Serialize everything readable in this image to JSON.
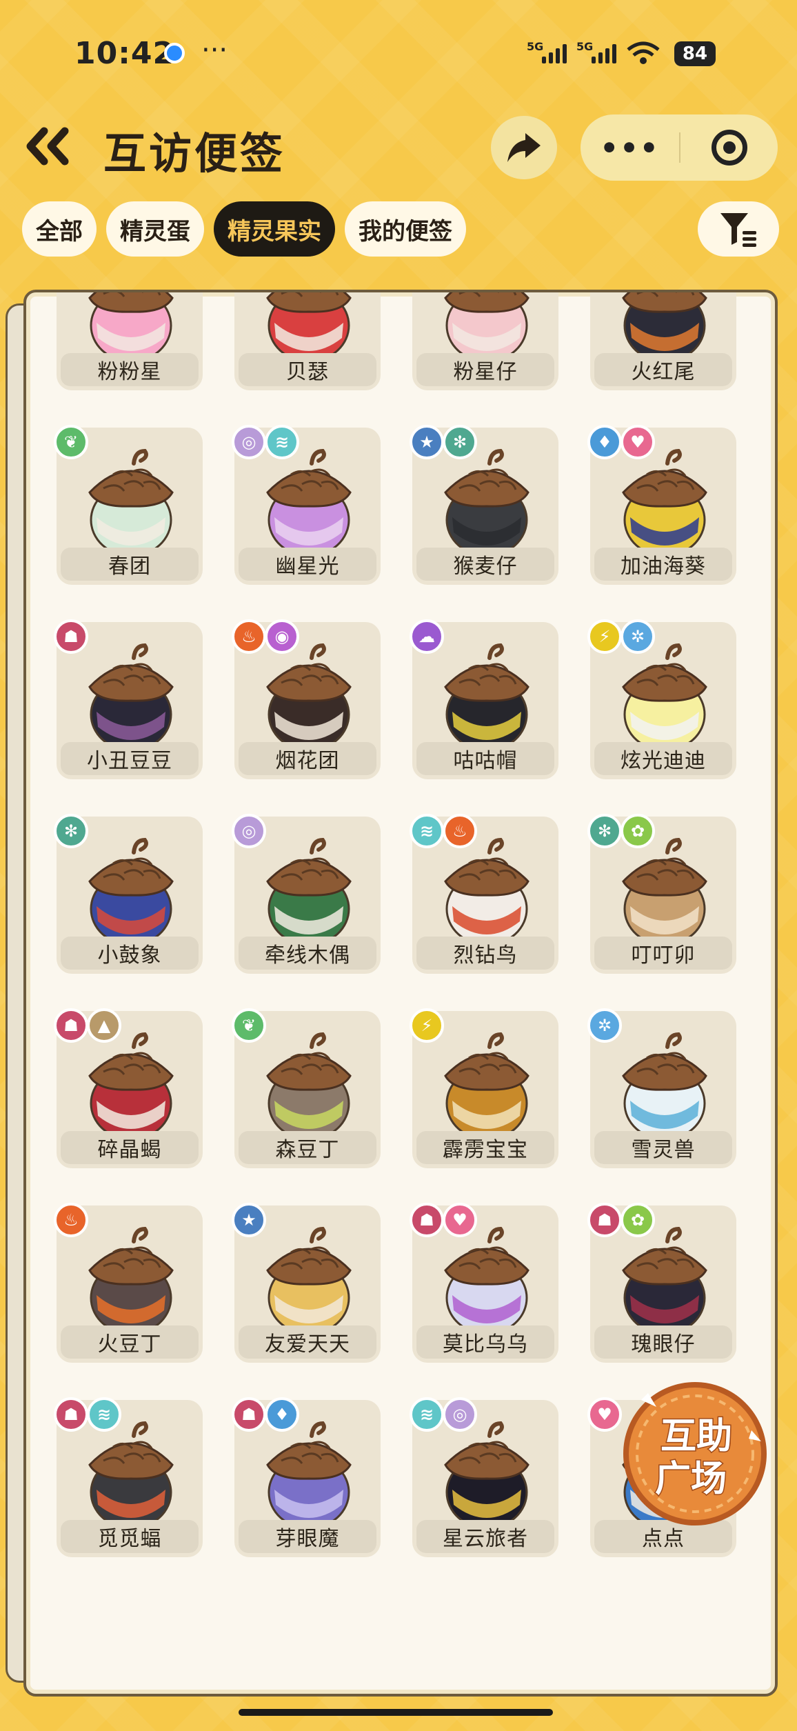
{
  "status_bar": {
    "time": "10:42",
    "more": "···",
    "sim1": "5G",
    "sim2": "5G",
    "battery": "84"
  },
  "header": {
    "title": "互访便签",
    "capsule_more": "•••"
  },
  "tabs": [
    {
      "label": "全部",
      "active": false
    },
    {
      "label": "精灵蛋",
      "active": false
    },
    {
      "label": "精灵果实",
      "active": true
    },
    {
      "label": "我的便签",
      "active": false
    }
  ],
  "colors": {
    "background": "#f7c94a",
    "panel": "#fbf7ee",
    "active_tab_bg": "#1e1a14",
    "active_tab_text": "#f6c65a"
  },
  "items": [
    {
      "name": "粉粉星",
      "badges": [],
      "colors": [
        "#f7a8c8",
        "#f2e8e0"
      ]
    },
    {
      "name": "贝瑟",
      "badges": [],
      "colors": [
        "#d94040",
        "#f2ece2"
      ]
    },
    {
      "name": "粉星仔",
      "badges": [],
      "colors": [
        "#f4c8cc",
        "#f2e8e0"
      ]
    },
    {
      "name": "火红尾",
      "badges": [],
      "colors": [
        "#2c2c38",
        "#e07a30"
      ]
    },
    {
      "name": "春团",
      "badges": [
        {
          "icon": "leaf-icon",
          "color": "#5dbb6a",
          "glyph": "❦"
        }
      ],
      "colors": [
        "#d6ead8",
        "#f2ece2"
      ]
    },
    {
      "name": "幽星光",
      "badges": [
        {
          "icon": "swirl-icon",
          "color": "#b89bd8",
          "glyph": "◎"
        },
        {
          "icon": "wing-icon",
          "color": "#5fc6c8",
          "glyph": "≋"
        }
      ],
      "colors": [
        "#c990e0",
        "#ead2f0"
      ]
    },
    {
      "name": "猴麦仔",
      "badges": [
        {
          "icon": "star-icon",
          "color": "#4a7fc0",
          "glyph": "★"
        },
        {
          "icon": "gear-icon",
          "color": "#4fa890",
          "glyph": "✻"
        }
      ],
      "colors": [
        "#3a3c40",
        "#2a2c30"
      ]
    },
    {
      "name": "加油海葵",
      "badges": [
        {
          "icon": "water-icon",
          "color": "#4a9ad8",
          "glyph": "♦"
        },
        {
          "icon": "heart-icon",
          "color": "#e86890",
          "glyph": "♥"
        }
      ],
      "colors": [
        "#e8c83a",
        "#2a3a90"
      ]
    },
    {
      "name": "小丑豆豆",
      "badges": [
        {
          "icon": "demon-icon",
          "color": "#c84a6a",
          "glyph": "☗"
        }
      ],
      "colors": [
        "#2a2838",
        "#8c5a9a"
      ]
    },
    {
      "name": "烟花团",
      "badges": [
        {
          "icon": "fire-icon",
          "color": "#e8642a",
          "glyph": "♨"
        },
        {
          "icon": "psychic-icon",
          "color": "#b860d0",
          "glyph": "◉"
        }
      ],
      "colors": [
        "#3a2c28",
        "#f2e8d8"
      ]
    },
    {
      "name": "咕咕帽",
      "badges": [
        {
          "icon": "ghost-icon",
          "color": "#9a5ad0",
          "glyph": "☁"
        }
      ],
      "colors": [
        "#26262c",
        "#e8d040"
      ]
    },
    {
      "name": "炫光迪迪",
      "badges": [
        {
          "icon": "lightning-icon",
          "color": "#e8c820",
          "glyph": "⚡"
        },
        {
          "icon": "ice-icon",
          "color": "#5aa8e0",
          "glyph": "✲"
        }
      ],
      "colors": [
        "#f6f0a0",
        "#f2f2f2"
      ]
    },
    {
      "name": "小鼓象",
      "badges": [
        {
          "icon": "gear-icon",
          "color": "#4fa890",
          "glyph": "✻"
        }
      ],
      "colors": [
        "#3a4aa0",
        "#d94a3a"
      ]
    },
    {
      "name": "牵线木偶",
      "badges": [
        {
          "icon": "swirl-icon",
          "color": "#b89bd8",
          "glyph": "◎"
        }
      ],
      "colors": [
        "#3a7a48",
        "#f2ece2"
      ]
    },
    {
      "name": "烈钻鸟",
      "badges": [
        {
          "icon": "wing-icon",
          "color": "#5fc6c8",
          "glyph": "≋"
        },
        {
          "icon": "fire-icon",
          "color": "#e8642a",
          "glyph": "♨"
        }
      ],
      "colors": [
        "#f2ece6",
        "#d94a2a"
      ]
    },
    {
      "name": "叮叮卯",
      "badges": [
        {
          "icon": "gear-icon",
          "color": "#4fa890",
          "glyph": "✻"
        },
        {
          "icon": "bug-icon",
          "color": "#8ac84a",
          "glyph": "✿"
        }
      ],
      "colors": [
        "#c8a070",
        "#f2e2c8"
      ]
    },
    {
      "name": "碎晶蝎",
      "badges": [
        {
          "icon": "demon-icon",
          "color": "#c84a6a",
          "glyph": "☗"
        },
        {
          "icon": "rock-icon",
          "color": "#b89a6a",
          "glyph": "▲"
        }
      ],
      "colors": [
        "#b8303a",
        "#f2ece2"
      ]
    },
    {
      "name": "森豆丁",
      "badges": [
        {
          "icon": "leaf-icon",
          "color": "#5dbb6a",
          "glyph": "❦"
        }
      ],
      "colors": [
        "#8c7a6a",
        "#c8d860"
      ]
    },
    {
      "name": "霹雳宝宝",
      "badges": [
        {
          "icon": "lightning-icon",
          "color": "#e8c820",
          "glyph": "⚡"
        }
      ],
      "colors": [
        "#c88a2a",
        "#f2e2b8"
      ]
    },
    {
      "name": "雪灵兽",
      "badges": [
        {
          "icon": "ice-icon",
          "color": "#5aa8e0",
          "glyph": "✲"
        }
      ],
      "colors": [
        "#e8f2f6",
        "#5ab0d8"
      ]
    },
    {
      "name": "火豆丁",
      "badges": [
        {
          "icon": "fire-icon",
          "color": "#e8642a",
          "glyph": "♨"
        }
      ],
      "colors": [
        "#5a4a48",
        "#e8702a"
      ]
    },
    {
      "name": "友爱天天",
      "badges": [
        {
          "icon": "star-icon",
          "color": "#4a7fc0",
          "glyph": "★"
        }
      ],
      "colors": [
        "#e8c060",
        "#f2e8d8"
      ]
    },
    {
      "name": "莫比乌乌",
      "badges": [
        {
          "icon": "demon-icon",
          "color": "#c84a6a",
          "glyph": "☗"
        },
        {
          "icon": "heart-icon",
          "color": "#e86890",
          "glyph": "♥"
        }
      ],
      "colors": [
        "#d8d8f0",
        "#b060d0"
      ]
    },
    {
      "name": "瑰眼仔",
      "badges": [
        {
          "icon": "demon-icon",
          "color": "#c84a6a",
          "glyph": "☗"
        },
        {
          "icon": "bug-icon",
          "color": "#8ac84a",
          "glyph": "✿"
        }
      ],
      "colors": [
        "#2a2838",
        "#a0304a"
      ]
    },
    {
      "name": "觅觅蝠",
      "badges": [
        {
          "icon": "demon-icon",
          "color": "#c84a6a",
          "glyph": "☗"
        },
        {
          "icon": "wing-icon",
          "color": "#5fc6c8",
          "glyph": "≋"
        }
      ],
      "colors": [
        "#3a3a3e",
        "#e0603a"
      ]
    },
    {
      "name": "芽眼魔",
      "badges": [
        {
          "icon": "demon-icon",
          "color": "#c84a6a",
          "glyph": "☗"
        },
        {
          "icon": "water-icon",
          "color": "#4a9ad8",
          "glyph": "♦"
        }
      ],
      "colors": [
        "#7a70c8",
        "#c8c0f0"
      ]
    },
    {
      "name": "星云旅者",
      "badges": [
        {
          "icon": "wing-icon",
          "color": "#5fc6c8",
          "glyph": "≋"
        },
        {
          "icon": "swirl-icon",
          "color": "#b89bd8",
          "glyph": "◎"
        }
      ],
      "colors": [
        "#1e1c28",
        "#e8c040"
      ]
    },
    {
      "name": "点点",
      "badges": [
        {
          "icon": "heart-icon",
          "color": "#e86890",
          "glyph": "♥"
        }
      ],
      "colors": [
        "#3a7ac8",
        "#f2ece2"
      ]
    }
  ],
  "helper_button": {
    "line1": "互助",
    "line2": "广场"
  }
}
